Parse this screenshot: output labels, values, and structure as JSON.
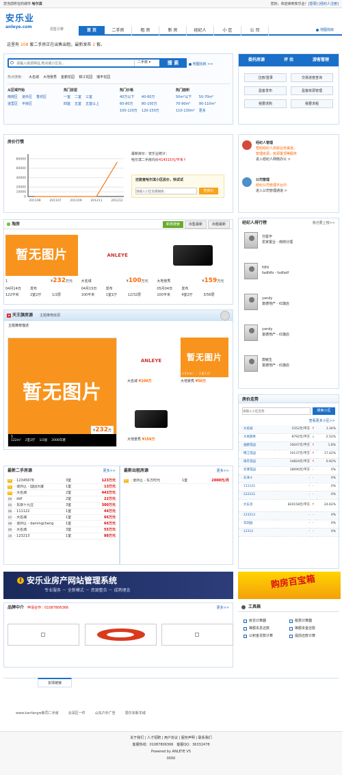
{
  "topbar": {
    "left_prefix": "您当前所在的城市",
    "city": "哈尔滨",
    "right_greet": "您好，欢迎来到安乐业！",
    "login": "[登录]",
    "broker_reg": "[经纪人注册]"
  },
  "logo": {
    "cn": "安乐业",
    "en": "anleye.com",
    "sub": "招售引擎"
  },
  "nav": {
    "items": [
      "首 页",
      "二手房",
      "租 房",
      "新 房",
      "经纪人",
      "小 区",
      "公 司"
    ],
    "map": "地图找房"
  },
  "stats": {
    "pre": "这里有",
    "count1": "208",
    "mid": "套二手房正在出售出租，最新发布",
    "count2": "2",
    "post": "套。"
  },
  "search": {
    "placeholder": "请输入房源特征,地点或小区名...",
    "type": "二手房",
    "button": "搜 索",
    "map": "地图找房 >>",
    "hot_label": "热点搜索：",
    "hot": [
      "大名城",
      "大地景秀",
      "金鹏花园",
      "锦江花园",
      "瑞丰花园"
    ]
  },
  "filters": [
    {
      "title": "从区域开始",
      "items": [
        "南岗区",
        "道外区",
        "香坊区",
        "道里区",
        "平房区"
      ]
    },
    {
      "title": "热门房型",
      "items": [
        "一室",
        "二室",
        "三室",
        "四室",
        "五室",
        "五室以上"
      ]
    },
    {
      "title": "热门价格",
      "items": [
        "40万以下",
        "40-60万",
        "60-80万",
        "80-100万",
        "100-120万",
        "120-150万"
      ]
    },
    {
      "title": "热门面积",
      "items": [
        "50m²以下",
        "50-70m²",
        "70-90m²",
        "90-110m²",
        "110-130m²",
        "更多"
      ]
    }
  ],
  "right_actions": {
    "tabs": [
      "委托房源",
      "评 估",
      "游客管理"
    ],
    "buttons": [
      "注册/登录",
      "交易进度查询",
      "盈客发布",
      "盈客房源管理",
      "我要求购",
      "我要求租"
    ]
  },
  "price_trend": {
    "title": "房价行情",
    "city_line": "最新房价：安乐业统计：",
    "avg_pre": "哈尔滨二手房均价",
    "avg_val": "414315元/平米",
    "avg_suf": "↑",
    "check_title": "还能查哈尔滨小区房价，快试试",
    "check_placeholder": "请输入小区名模糊搜...",
    "check_btn": "查房价"
  },
  "chart_data": {
    "type": "line",
    "categories": [
      "201108",
      "201107",
      "201109",
      "201211",
      "201212"
    ],
    "values": [
      0,
      0,
      0,
      0,
      72000
    ],
    "ylim": [
      0,
      90000
    ],
    "yticks": [
      "80000",
      "60000",
      "40000",
      "20000",
      "10000",
      "0"
    ]
  },
  "broker_mgmt": [
    {
      "title": "经纪人管理",
      "desc1": "帮助经纪人抓获业务渠道，",
      "desc2": "管理房源，房源置顶等服务",
      "link": "进入经纪人网络办公 >"
    },
    {
      "title": "公司管理",
      "desc1": "经纪公司管理平台中",
      "desc2": "",
      "link": "进入公司管理通道 >"
    }
  ],
  "taofang": {
    "title": "淘房",
    "tabs": [
      "新称搜索",
      "出售最新",
      "出租最新"
    ],
    "items": [
      {
        "price": "232",
        "unit": "万元",
        "name": "1",
        "date": "04月14日",
        "area": "122平米",
        "room": "2室2厅",
        "floor": "1/2层",
        "status": "发布"
      },
      {
        "price": "100",
        "unit": "万元",
        "name": "大名城",
        "date": "04月15日",
        "area": "100平米",
        "room": "1室1厅",
        "floor": "12/32层",
        "status": "发布"
      },
      {
        "price": "159",
        "unit": "万元",
        "name": "大地景秀",
        "date": "05月04日",
        "area": "100平米",
        "room": "4室2厅",
        "floor": "3/56层",
        "status": "发布"
      }
    ]
  },
  "tianwang": {
    "title": "天王旗房源",
    "sub": "主题推荐房源",
    "desc": "主题推荐描述",
    "big": {
      "price": "232",
      "unit": "万",
      "meta": [
        "122m²",
        "2室2厅",
        "1/2层",
        "2006年建"
      ],
      "label": "1"
    },
    "items": [
      {
        "name": "大名城",
        "price": "100万"
      },
      {
        "name": "大地景秀",
        "price": "50万",
        "meta": "145m²",
        "meta2": "3室1厅"
      },
      {
        "name": "大地景秀",
        "price": "159万"
      }
    ]
  },
  "no_image": "暂无图片",
  "broker_rank": {
    "title": "经纪人排行榜",
    "more": "我也要上榜>>",
    "items": [
      {
        "name": "刘善宇",
        "co": "爱家置业 - 南岗分理"
      },
      {
        "name": "fdfd",
        "co": "fadfdfs - fsdfsdf"
      },
      {
        "name": "yandy",
        "co": "富德地产 - 红旗店"
      },
      {
        "name": "yandy",
        "co": "富德地产 - 红旗店"
      },
      {
        "name": "唐敏生",
        "co": "富德地产 - 红旗店"
      }
    ]
  },
  "house_trend": {
    "title": "房价走势",
    "placeholder": "请输入小区名称",
    "button": "搜索小区",
    "more": "查看更多小区>>",
    "rows": [
      {
        "name": "大名城",
        "price": "5352元/平方",
        "arrow": "↑",
        "pct": "1.34%"
      },
      {
        "name": "大地景秀",
        "price": "8792元/平方",
        "arrow": "↓",
        "pct": "2.52%"
      },
      {
        "name": "金鹏花园",
        "price": "10047元/平方",
        "arrow": "↑",
        "pct": "1.8%"
      },
      {
        "name": "锦江花园",
        "price": "10137元/平方",
        "arrow": "↑",
        "pct": "17.42%"
      },
      {
        "name": "瑞丰花园",
        "price": "14824元/平方",
        "arrow": "↑",
        "pct": "0.92%"
      },
      {
        "name": "华港花园",
        "price": "18090元/平方",
        "arrow": "-",
        "pct": "0%"
      },
      {
        "name": "东泽十",
        "price": "-",
        "arrow": "-",
        "pct": "0%"
      },
      {
        "name": "111122",
        "price": "-",
        "arrow": "-",
        "pct": "0%"
      },
      {
        "name": "222222",
        "price": "-",
        "arrow": "-",
        "pct": "0%"
      },
      {
        "name": "大东流",
        "price": "820158元/平方",
        "arrow": "↑",
        "pct": "24.62%"
      },
      {
        "name": "123213",
        "price": "-",
        "arrow": "-",
        "pct": "0%"
      },
      {
        "name": "华润园",
        "price": "-",
        "arrow": "-",
        "pct": "0%"
      },
      {
        "name": "12312",
        "price": "-",
        "arrow": "-",
        "pct": "0%"
      }
    ]
  },
  "latest_sale": {
    "title": "最新二手房源",
    "more": "更多>>",
    "rows": [
      {
        "n": "01",
        "name": "12345678",
        "room": "3室",
        "price": "123万元"
      },
      {
        "n": "02",
        "name": "道外区 - 国团大厦",
        "room": "1室",
        "price": "13万元"
      },
      {
        "n": "03",
        "name": "大名城",
        "room": "2室",
        "price": "443万元"
      },
      {
        "n": "04",
        "name": "ddf",
        "room": "2室",
        "price": "22万元"
      },
      {
        "n": "05",
        "name": "东岸十九庄",
        "room": "3室",
        "price": "300万元"
      },
      {
        "n": "06",
        "name": "111122",
        "room": "1室",
        "price": "44万元"
      },
      {
        "n": "07",
        "name": "大名城",
        "room": "1室",
        "price": "66万元"
      },
      {
        "n": "08",
        "name": "道外区 - damingcheng",
        "room": "1室",
        "price": "66万元"
      },
      {
        "n": "09",
        "name": "大名城",
        "room": "3室",
        "price": "55万元"
      },
      {
        "n": "10",
        "name": "123213",
        "room": "1室",
        "price": "88万元"
      }
    ]
  },
  "latest_rent": {
    "title": "最新出租房源",
    "more": "更多>>",
    "rows": [
      {
        "n": "01",
        "name": "道外区 - 东方时代",
        "room": "1室",
        "price": "2000元/月"
      }
    ]
  },
  "banner": {
    "text": "安乐业房产网站管理系统",
    "sub": "专业服务 － 全新模式 － 资源整合 － 成熟理念",
    "ad": "购房百宝箱"
  },
  "brand": {
    "title": "品牌中介",
    "join": "申请合作：01087806366",
    "more": "更多>>"
  },
  "tools": {
    "title": "工具箱",
    "items": [
      "房贷计算器",
      "税费计算器",
      "等额本息还款",
      "等额本金还款",
      "公积金贷款计算",
      "提前还款计算"
    ]
  },
  "friend": {
    "tab": "友情链接",
    "links": [
      "www.kanfangw新同二手房",
      "云深区一件",
      "山东户外广告",
      "鄂尔多斯羊绒"
    ]
  },
  "footer": {
    "links": "关于我们 | 人才招聘 | 用户协议 | 服务声明 | 联系我们",
    "hotline_label": "客服热线：",
    "hotline": "01087806366",
    "qq_label": "客服QQ：",
    "qq": "36332478",
    "powered": "Powered by ANLEYE V5",
    "code": "0000"
  }
}
